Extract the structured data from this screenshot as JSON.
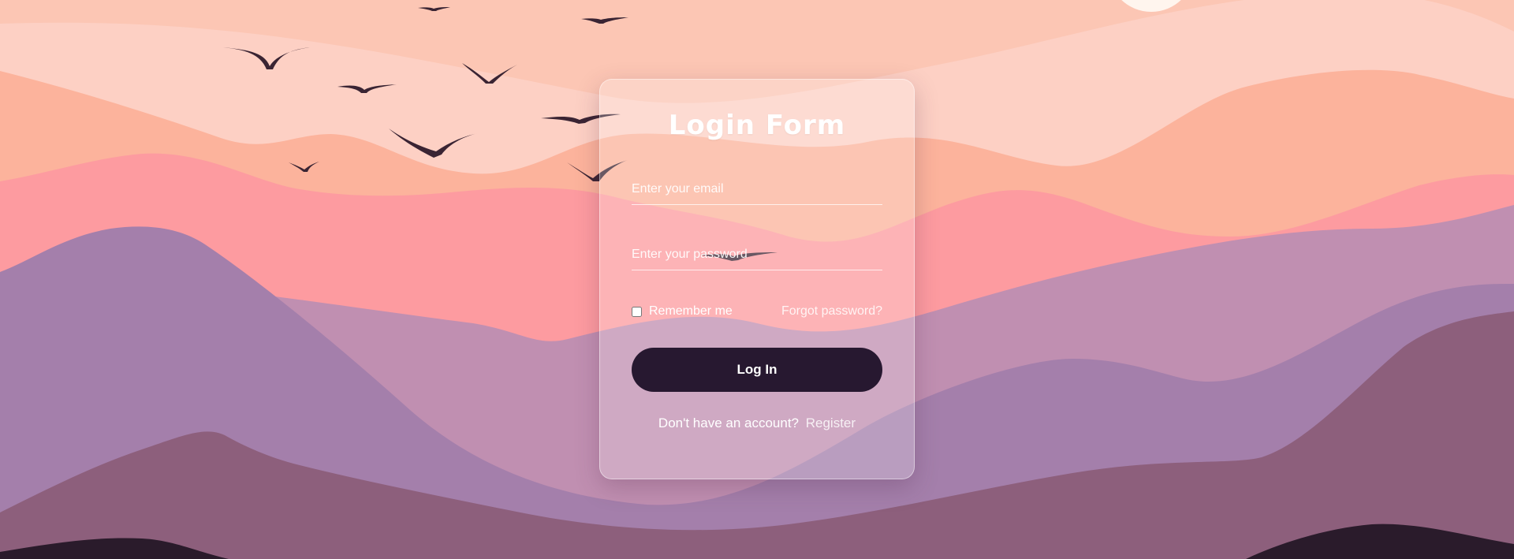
{
  "background": {
    "sky": "#fcc6b4",
    "sun": "#ffffff",
    "bird_color": "#3a2433",
    "layers": [
      "#fdd0c4",
      "#fcb39c",
      "#fd9ba0",
      "#c08fb1",
      "#a47fab",
      "#8d5f7c",
      "#2a1b2b"
    ],
    "bird_icon": "bird-silhouette-icon"
  },
  "login": {
    "title": "Login Form",
    "email_placeholder": "Enter your email",
    "password_placeholder": "Enter your password",
    "remember_label": "Remember me",
    "forgot_label": "Forgot password?",
    "submit_label": "Log In",
    "register_prompt": "Don't have an account?",
    "register_label": "Register"
  }
}
